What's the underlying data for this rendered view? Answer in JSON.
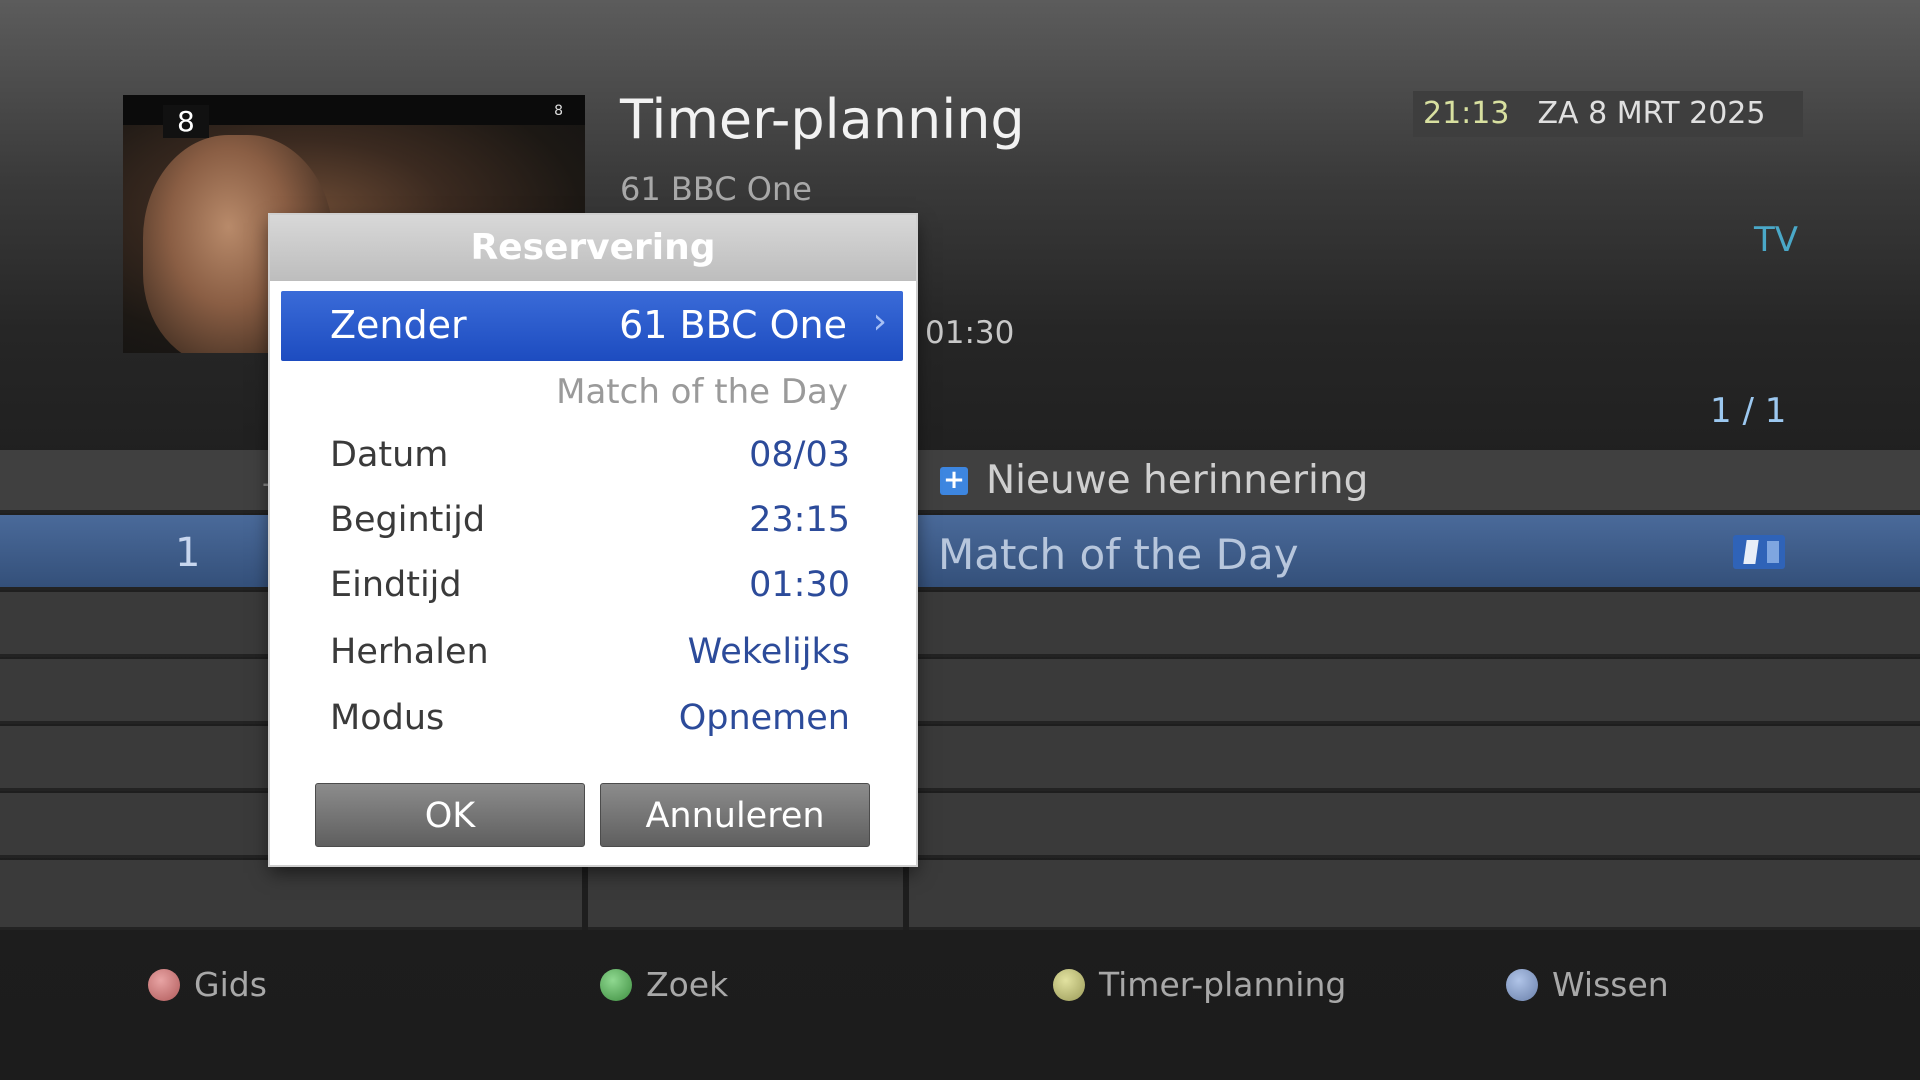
{
  "header": {
    "title": "Timer-planning",
    "subchannel": "61 BBC One",
    "time": "21:13",
    "date": "ZA 8 MRT 2025",
    "mode": "TV",
    "end_time": "01:30",
    "page_indicator": "1 /  1"
  },
  "preview": {
    "channel_left": "8",
    "channel_right": "8"
  },
  "list": {
    "new_reminder": "Nieuwe herinnering",
    "selected_row": {
      "number": "1",
      "program": "Match of the Day"
    }
  },
  "dialog": {
    "title": "Reservering",
    "zender_label": "Zender",
    "zender_value": "61 BBC One",
    "program": "Match of the Day",
    "rows": [
      {
        "label": "Datum",
        "value": "08/03"
      },
      {
        "label": "Begintijd",
        "value": "23:15"
      },
      {
        "label": "Eindtijd",
        "value": "01:30"
      },
      {
        "label": "Herhalen",
        "value": "Wekelijks"
      },
      {
        "label": "Modus",
        "value": "Opnemen"
      }
    ],
    "ok_label": "OK",
    "cancel_label": "Annuleren"
  },
  "footer": {
    "red": "Gids",
    "green": "Zoek",
    "yellow": "Timer-planning",
    "blue": "Wissen"
  },
  "colors": {
    "selection_blue": "#1d4cc0",
    "value_blue": "#2c4b9a",
    "highlight_row": "#34507a"
  }
}
